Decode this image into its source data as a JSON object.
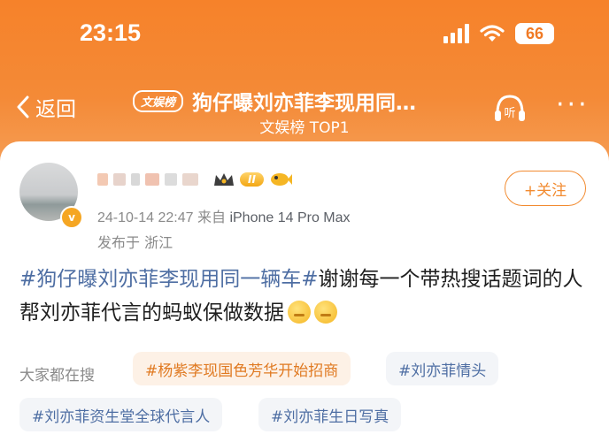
{
  "status_bar": {
    "time": "23:15",
    "battery": "66"
  },
  "nav": {
    "back_label": "返回",
    "badge": "文娱榜",
    "title": "狗仔曝刘亦菲李现用同…",
    "subtitle": "文娱榜 TOP1",
    "listen_label": "听",
    "more": "···"
  },
  "post": {
    "level": "II",
    "verify_mark": "v",
    "meta_date": "24-10-14 22:47",
    "meta_from": "来自",
    "meta_device": "iPhone 14 Pro Max",
    "location": "发布于 浙江",
    "follow_label": "+关注",
    "tag": "#狗仔曝刘亦菲李现用同一辆车#",
    "text": "谢谢每一个带热搜话题词的人帮刘亦菲代言的蚂蚁保做数据"
  },
  "search": {
    "label": "大家都在搜",
    "chips": [
      "#杨紫李现国色芳华开始招商",
      "#刘亦菲情头",
      "#刘亦菲资生堂全球代言人",
      "#刘亦菲生日写真"
    ]
  },
  "colors": {
    "header": "#f6822a",
    "accent": "#f28b30",
    "link": "#4e6ea3"
  }
}
